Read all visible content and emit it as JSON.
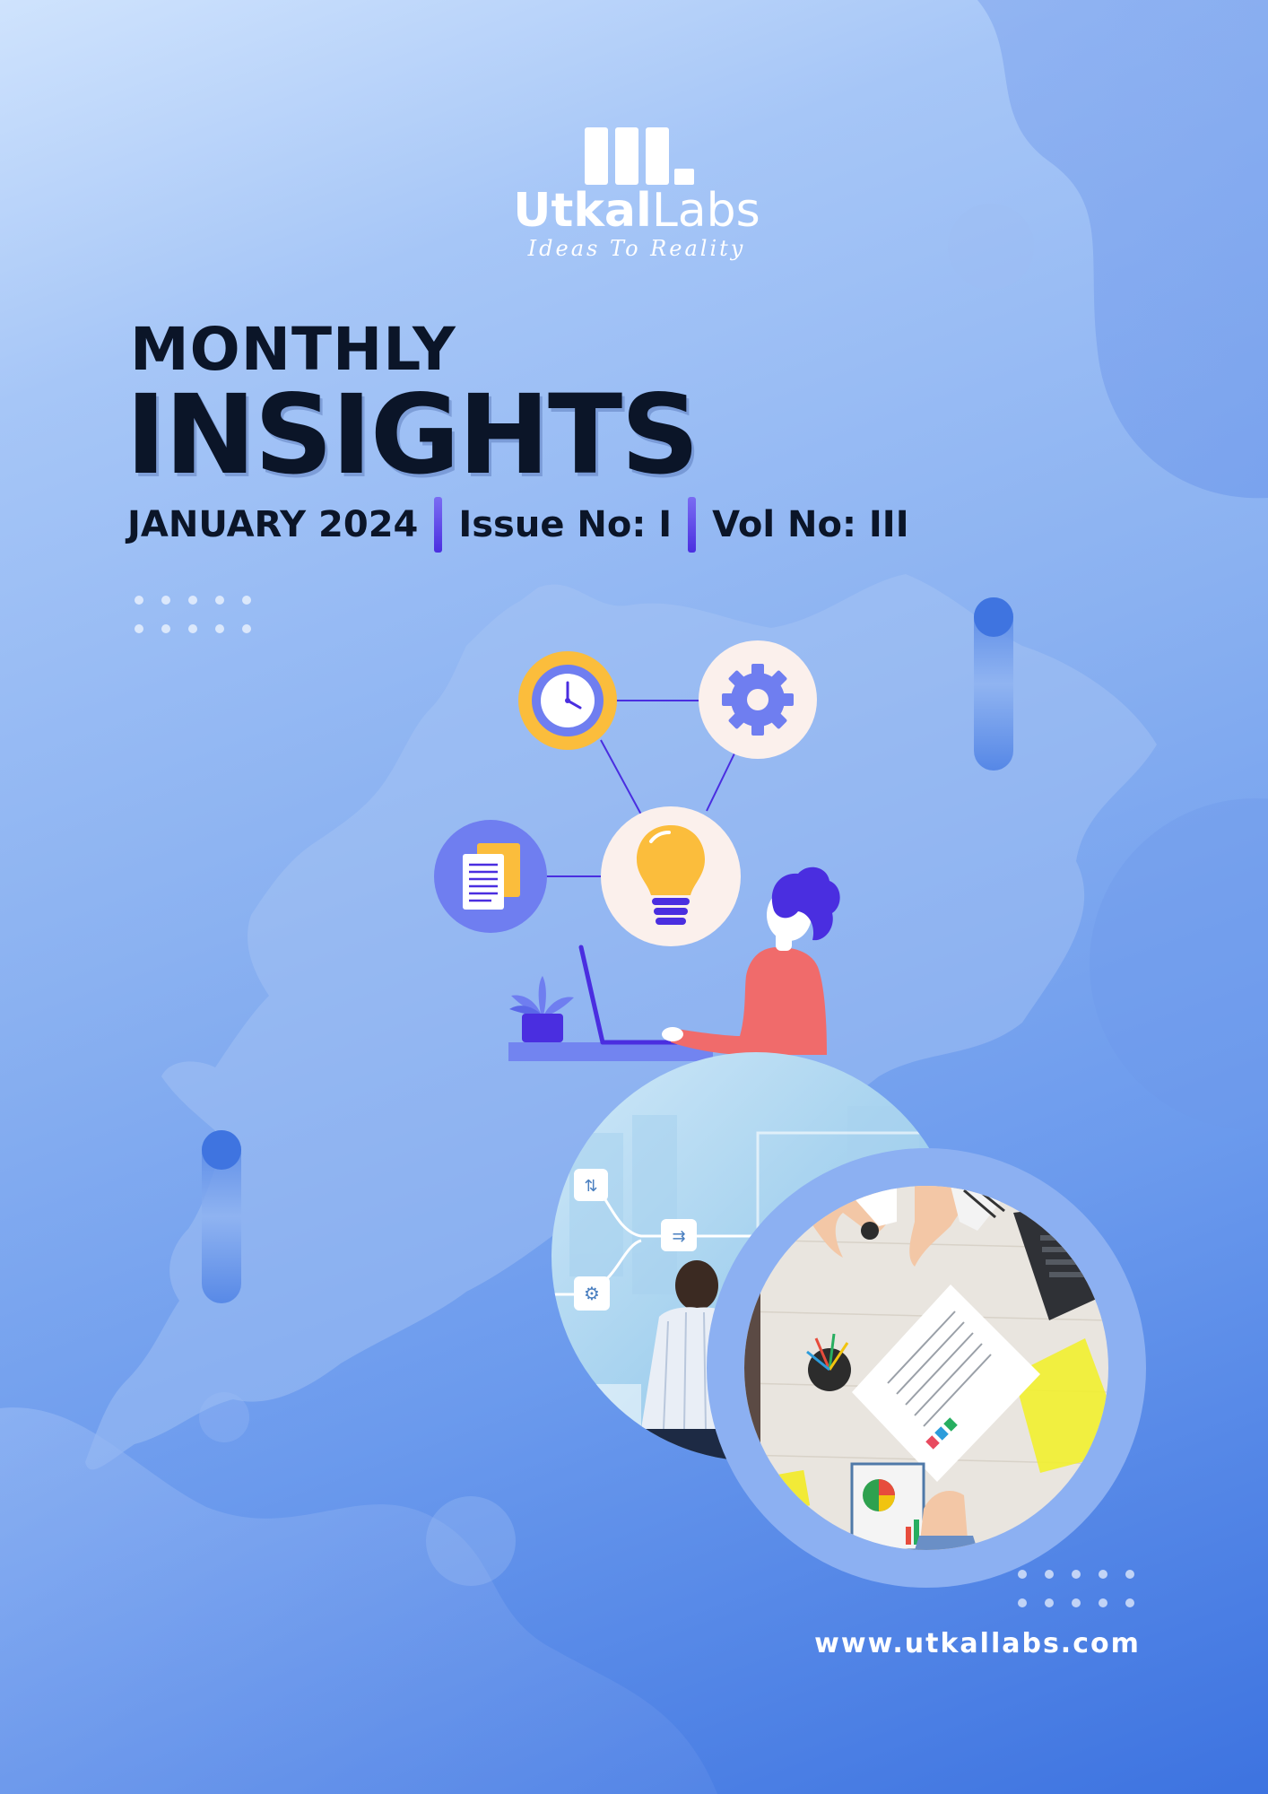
{
  "brand": {
    "name_bold": "Utkal",
    "name_light": "Labs",
    "tagline": "Ideas To Reality"
  },
  "cover": {
    "kicker": "MONTHLY",
    "title": "INSIGHTS",
    "date": "JANUARY 2024",
    "issue": "Issue No: I",
    "volume": "Vol No: III"
  },
  "footer": {
    "website": "www.utkallabs.com"
  },
  "colors": {
    "title_text": "#0b1528",
    "separator": "#5b3ee6",
    "accent_yellow": "#fbbd3c",
    "accent_indigo": "#4a2ee0",
    "figure_shirt": "#f06b6b"
  },
  "illustration": {
    "icons": [
      "clock-icon",
      "gear-icon",
      "lightbulb-icon",
      "documents-icon",
      "plant-icon",
      "laptop-icon",
      "person-figure"
    ]
  },
  "photos": [
    "technology-workflow-photo",
    "team-meeting-photo"
  ]
}
